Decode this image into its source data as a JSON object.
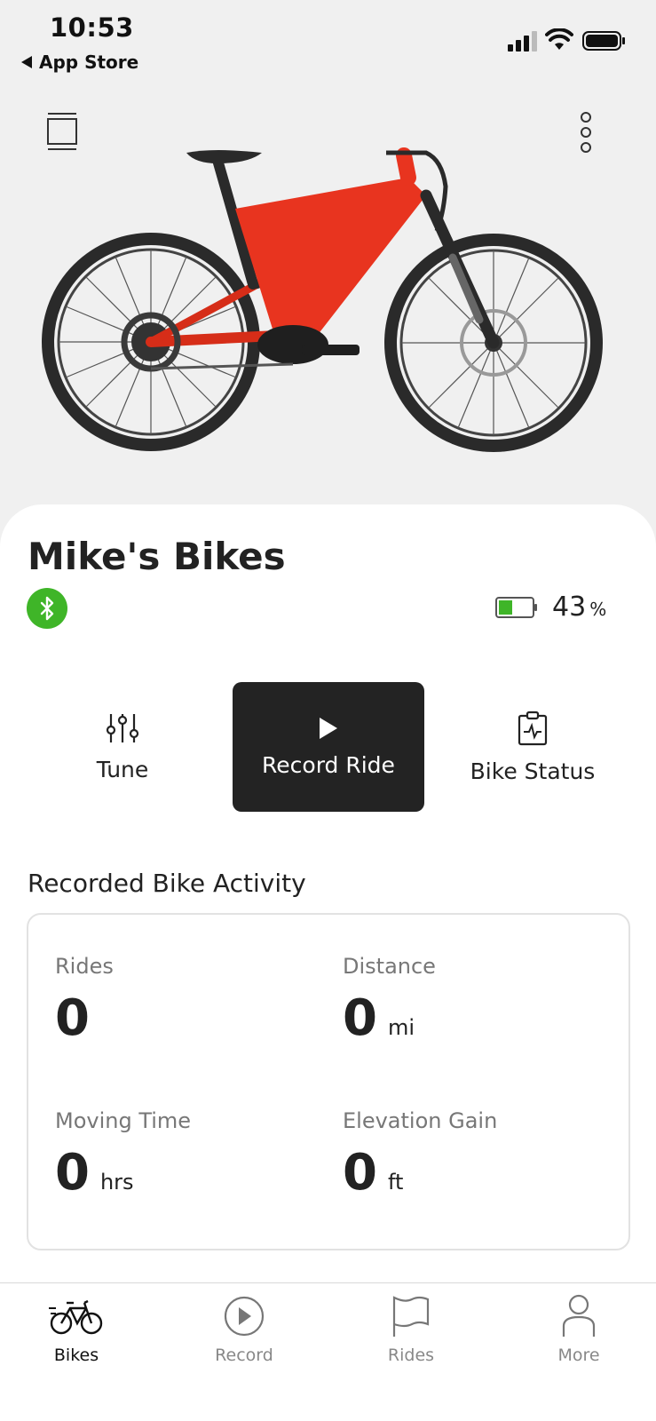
{
  "status_bar": {
    "time": "10:53",
    "back_label": "App Store"
  },
  "header": {
    "bike_name": "Mike's Bikes",
    "battery_value": "43",
    "battery_unit": "%",
    "battery_level": 0.43,
    "bluetooth_color": "#3fb528",
    "battery_color": "#3fb528"
  },
  "actions": {
    "tune": "Tune",
    "record_ride": "Record Ride",
    "bike_status": "Bike Status"
  },
  "activity": {
    "title": "Recorded Bike Activity",
    "stats": [
      {
        "label": "Rides",
        "value": "0",
        "unit": ""
      },
      {
        "label": "Distance",
        "value": "0",
        "unit": "mi"
      },
      {
        "label": "Moving Time",
        "value": "0",
        "unit": "hrs"
      },
      {
        "label": "Elevation Gain",
        "value": "0",
        "unit": "ft"
      }
    ]
  },
  "tabs": [
    {
      "label": "Bikes",
      "icon": "bike-icon",
      "active": true
    },
    {
      "label": "Record",
      "icon": "play-circle-icon",
      "active": false
    },
    {
      "label": "Rides",
      "icon": "flag-icon",
      "active": false
    },
    {
      "label": "More",
      "icon": "person-icon",
      "active": false
    }
  ],
  "colors": {
    "accent_dark": "#232323",
    "bike_frame": "#e8341f"
  }
}
